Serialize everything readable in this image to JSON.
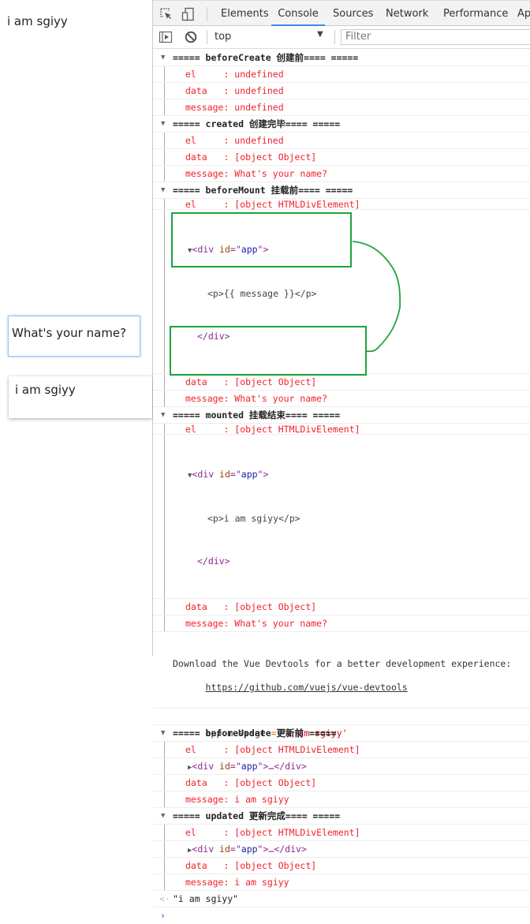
{
  "page": {
    "paragraph": "i am sgiyy",
    "box_input": "What's your name?",
    "box_output": "i am sgiyy"
  },
  "devtools": {
    "tabs": [
      "Elements",
      "Console",
      "Sources",
      "Network",
      "Performance",
      "Ap"
    ],
    "active_tab": "Console",
    "toolbar": {
      "context": "top",
      "filter_placeholder": "Filter"
    },
    "icons": {
      "inspect": "inspect-element-icon",
      "device": "device-toggle-icon",
      "sidebar": "console-sidebar-icon",
      "clear": "clear-console-icon"
    },
    "console": {
      "groups": [
        {
          "title": "===== beforeCreate 创建前==== =====",
          "el": "el     : undefined",
          "data": "data   : undefined",
          "message": "message: undefined"
        },
        {
          "title": "===== created 创建完毕==== =====",
          "el": "el     : undefined",
          "data": "data   : [object Object]",
          "message": "message: What's your name?"
        },
        {
          "title": "===== beforeMount 挂载前==== =====",
          "el": "el     : [object HTMLDivElement]",
          "tree_open": "<div id=\"app\">",
          "tree_child": "<p>{{ message }}</p>",
          "tree_close": "</div>",
          "data": "data   : [object Object]",
          "message": "message: What's your name?"
        },
        {
          "title": "===== mounted 挂载结束==== =====",
          "el": "el     : [object HTMLDivElement]",
          "tree_open": "<div id=\"app\">",
          "tree_child": "<p>i am sgiyy</p>",
          "tree_close": "</div>",
          "data": "data   : [object Object]",
          "message": "message: What's your name?"
        }
      ],
      "devtools_msg": "Download the Vue Devtools for a better development experience:",
      "devtools_link": "https://github.com/vuejs/vue-devtools",
      "command": {
        "lhs": "app.message",
        "op": " = ",
        "rhs": "'i am sgiyy'"
      },
      "groups2": [
        {
          "title": "===== beforeUpdate 更新前 =====",
          "el": "el     : [object HTMLDivElement]",
          "tree_collapsed": "<div id=\"app\">…</div>",
          "data": "data   : [object Object]",
          "message": "message: i am sgiyy"
        },
        {
          "title": "===== updated 更新完成==== =====",
          "el": "el     : [object HTMLDivElement]",
          "tree_collapsed": "<div id=\"app\">…</div>",
          "data": "data   : [object Object]",
          "message": "message: i am sgiyy"
        }
      ],
      "result": "\"i am sgiyy\"",
      "prompt_symbol": ">",
      "result_symbol": "<·"
    }
  },
  "annotation_color": "#1ea33c"
}
